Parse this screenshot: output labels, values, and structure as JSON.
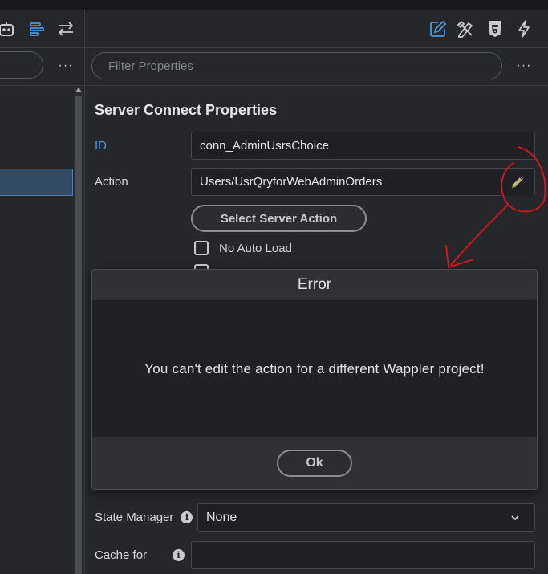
{
  "left_panel": {
    "toolbar_icons": [
      "robot-icon",
      "align-left-icon",
      "swap-arrows-icon"
    ],
    "more_label": "···"
  },
  "right_panel": {
    "toolbar_icons": [
      "edit-icon",
      "design-tools-icon",
      "css3-icon",
      "lightning-icon"
    ],
    "filter_placeholder": "Filter Properties",
    "more_label": "···",
    "section_title": "Server Connect Properties",
    "id_label": "ID",
    "id_value": "conn_AdminUsrsChoice",
    "action_label": "Action",
    "action_value": "Users/UsrQryforWebAdminOrders",
    "select_server_action_label": "Select Server Action",
    "no_auto_load_label": "No Auto Load",
    "state_manager_label": "State Manager",
    "state_manager_value": "None",
    "cache_for_label": "Cache for",
    "cache_for_value": ""
  },
  "modal": {
    "title": "Error",
    "message": "You can't edit the action for a different Wappler project!",
    "ok_label": "Ok"
  },
  "colors": {
    "accent_blue": "#4a9ae6",
    "annotation_red": "#e0141b",
    "background": "#25272b"
  }
}
